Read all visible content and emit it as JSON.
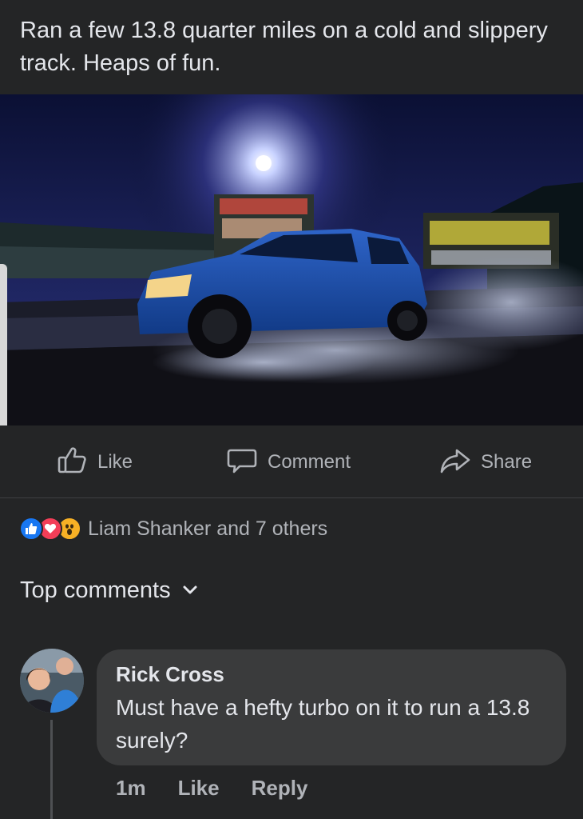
{
  "post": {
    "text": "Ran a few 13.8 quarter miles on a cold and slippery track. Heaps of fun."
  },
  "actions": {
    "like": "Like",
    "comment": "Comment",
    "share": "Share"
  },
  "reactions": {
    "summary": "Liam Shanker and 7 others",
    "icons": [
      "like-reaction-icon",
      "love-reaction-icon",
      "wow-reaction-icon"
    ]
  },
  "comments_section": {
    "header": "Top comments"
  },
  "comments": [
    {
      "author": "Rick Cross",
      "text": "Must have a hefty turbo on it to run a 13.8 surely?",
      "time": "1m",
      "like_label": "Like",
      "reply_label": "Reply"
    }
  ],
  "colors": {
    "background": "#242526",
    "bubble": "#3a3b3c",
    "like_blue": "#1877f2",
    "love_red": "#f33e58",
    "wow_yellow": "#f7b125"
  }
}
